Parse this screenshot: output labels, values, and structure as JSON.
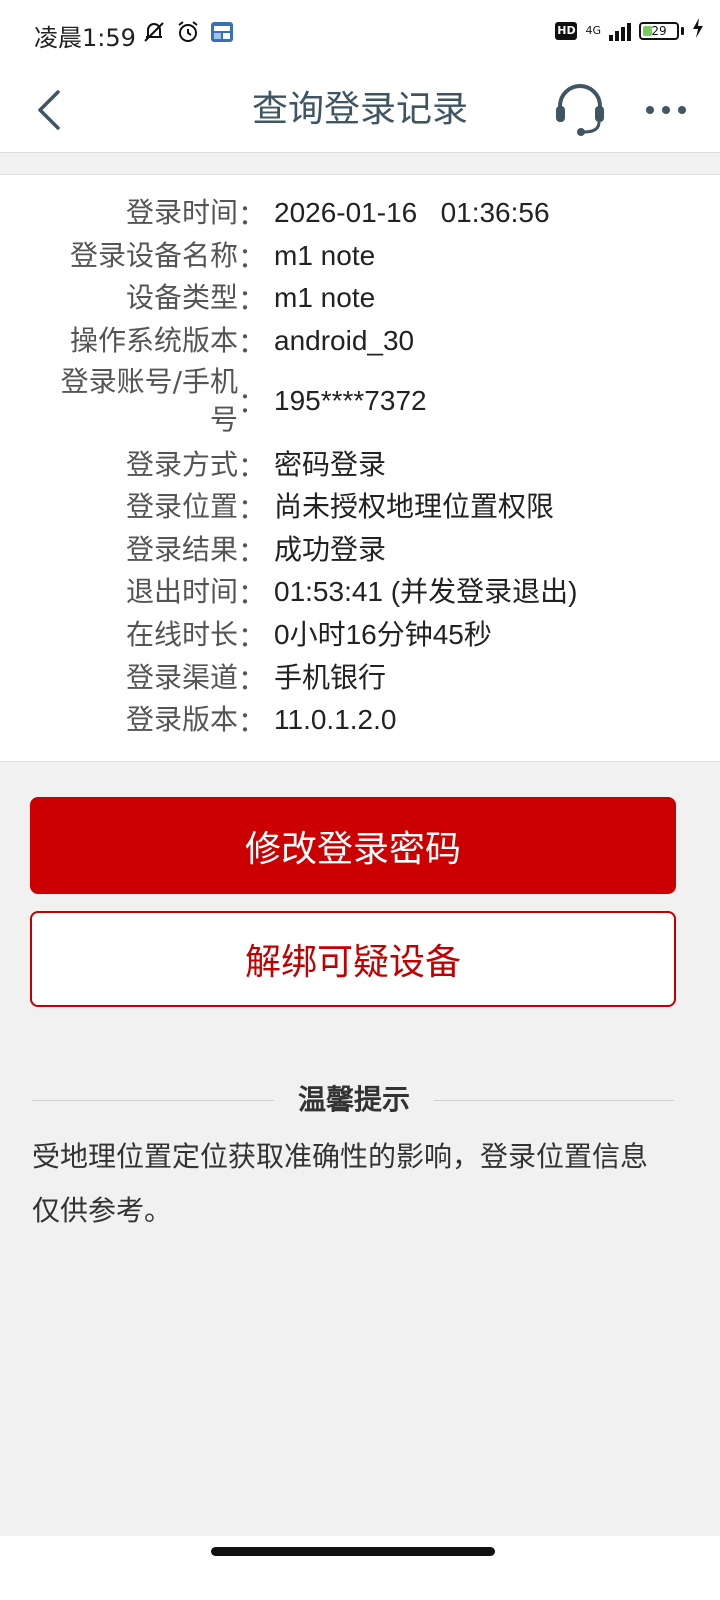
{
  "status_bar": {
    "time": "凌晨1:59",
    "hd": "HD",
    "network": "4G",
    "battery": "29",
    "battery_level": 0.29
  },
  "header": {
    "title": "查询登录记录"
  },
  "details": [
    {
      "label": "登录时间",
      "value": "2026-01-16   01:36:56"
    },
    {
      "label": "登录设备名称",
      "value": "m1 note"
    },
    {
      "label": "设备类型",
      "value": "m1 note"
    },
    {
      "label": "操作系统版本",
      "value": "android_30"
    },
    {
      "label_line1": "登录账号/手机",
      "label_line2": "号",
      "value": "195****7372"
    },
    {
      "label": "登录方式",
      "value": "密码登录"
    },
    {
      "label": "登录位置",
      "value": "尚未授权地理位置权限"
    },
    {
      "label": "登录结果",
      "value": "成功登录"
    },
    {
      "label": "退出时间",
      "value": "01:53:41 (并发登录退出)"
    },
    {
      "label": "在线时长",
      "value": "0小时16分钟45秒"
    },
    {
      "label": "登录渠道",
      "value": "手机银行"
    },
    {
      "label": "登录版本",
      "value": "11.0.1.2.0"
    }
  ],
  "colon": "：",
  "buttons": {
    "change_password": "修改登录密码",
    "unbind_device": "解绑可疑设备"
  },
  "tip": {
    "title": "温馨提示",
    "text": "受地理位置定位获取准确性的影响，登录位置信息仅供参考。"
  },
  "colors": {
    "primary": "#cc0000",
    "title": "#3f5563",
    "background": "#f1f1f1"
  }
}
